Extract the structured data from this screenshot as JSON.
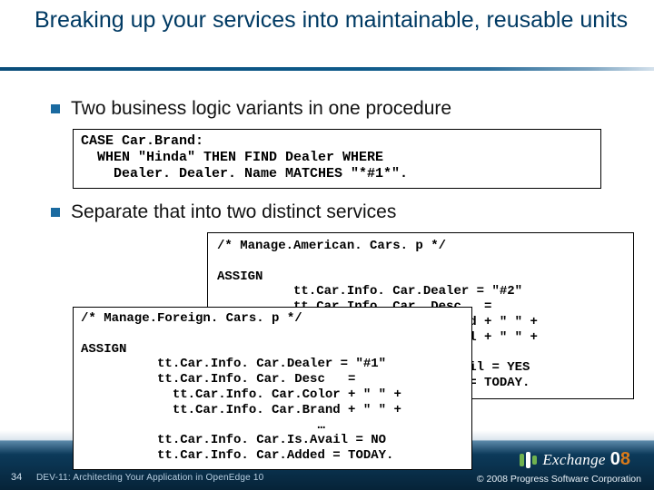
{
  "title": "Breaking up your services into maintainable, reusable units",
  "bullets": {
    "b1": "Two business logic variants in one procedure",
    "b2": "Separate that into two distinct services"
  },
  "code": {
    "case_block": "CASE Car.Brand:\n  WHEN \"Hinda\" THEN FIND Dealer WHERE\n    Dealer. Dealer. Name MATCHES \"*#1*\".",
    "american": "/* Manage.American. Cars. p */\n\nASSIGN\n          tt.Car.Info. Car.Dealer = \"#2\"\n          tt.Car.Info. Car. Desc   =\n            tt.Car.Info. Car.Brand + \" \" +\n            tt.Car.Info. Car.Model + \" \" +\n                               …\n          tt.Car.Info. Car.Is.Avail = YES\n          tt.Car.Info. Car.Added = TODAY.",
    "foreign": "/* Manage.Foreign. Cars. p */\n\nASSIGN\n          tt.Car.Info. Car.Dealer = \"#1\"\n          tt.Car.Info. Car. Desc   =\n            tt.Car.Info. Car.Color + \" \" +\n            tt.Car.Info. Car.Brand + \" \" +\n                               …\n          tt.Car.Info. Car.Is.Avail = NO\n          tt.Car.Info. Car.Added = TODAY."
  },
  "footer": {
    "slide_num": "34",
    "session": "DEV-11: Architecting Your Application in OpenEdge 10",
    "copyright": "© 2008 Progress Software Corporation",
    "logo_word": "Exchange",
    "logo_year_a": "0",
    "logo_year_b": "8"
  }
}
